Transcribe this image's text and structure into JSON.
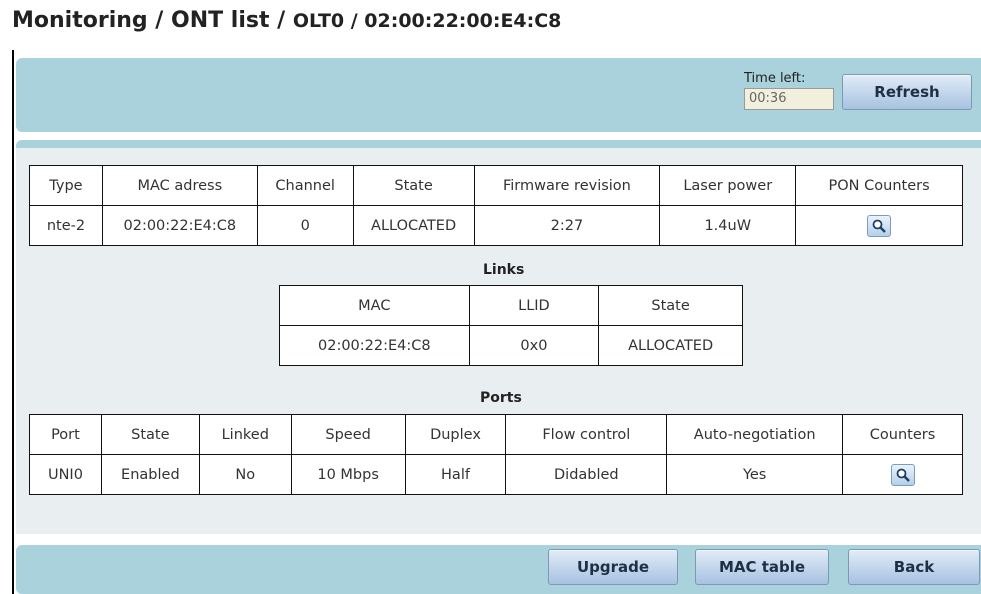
{
  "header": {
    "title_main": "Monitoring / ONT list / ",
    "title_sub": "OLT0 /  02:00:22:00:E4:C8"
  },
  "toolbar": {
    "time_left_label": "Time left:",
    "time_left_value": "00:36",
    "refresh_label": "Refresh"
  },
  "ont_table": {
    "headers": [
      "Type",
      "MAC adress",
      "Channel",
      "State",
      "Firmware revision",
      "Laser power",
      "PON Counters"
    ],
    "row": {
      "type": "nte-2",
      "mac": "02:00:22:E4:C8",
      "channel": "0",
      "state": "ALLOCATED",
      "firmware": "2:27",
      "laser_power": "1.4uW",
      "pon_counters_icon": "magnifier-icon"
    }
  },
  "links": {
    "title": "Links",
    "headers": [
      "MAC",
      "LLID",
      "State"
    ],
    "row": {
      "mac": "02:00:22:E4:C8",
      "llid": "0x0",
      "state": "ALLOCATED"
    }
  },
  "ports": {
    "title": "Ports",
    "headers": [
      "Port",
      "State",
      "Linked",
      "Speed",
      "Duplex",
      "Flow control",
      "Auto-negotiation",
      "Counters"
    ],
    "row": {
      "port": "UNI0",
      "state": "Enabled",
      "linked": "No",
      "speed": "10 Mbps",
      "duplex": "Half",
      "flow_control": "Didabled",
      "auto_negotiation": "Yes",
      "counters_icon": "magnifier-icon"
    }
  },
  "footer": {
    "upgrade_label": "Upgrade",
    "mac_table_label": "MAC table",
    "back_label": "Back"
  },
  "colors": {
    "panel": "#a9d2dc",
    "content_bg": "#e9eef1",
    "button_top": "#e1ecf7",
    "button_bottom": "#a7c2e1"
  }
}
